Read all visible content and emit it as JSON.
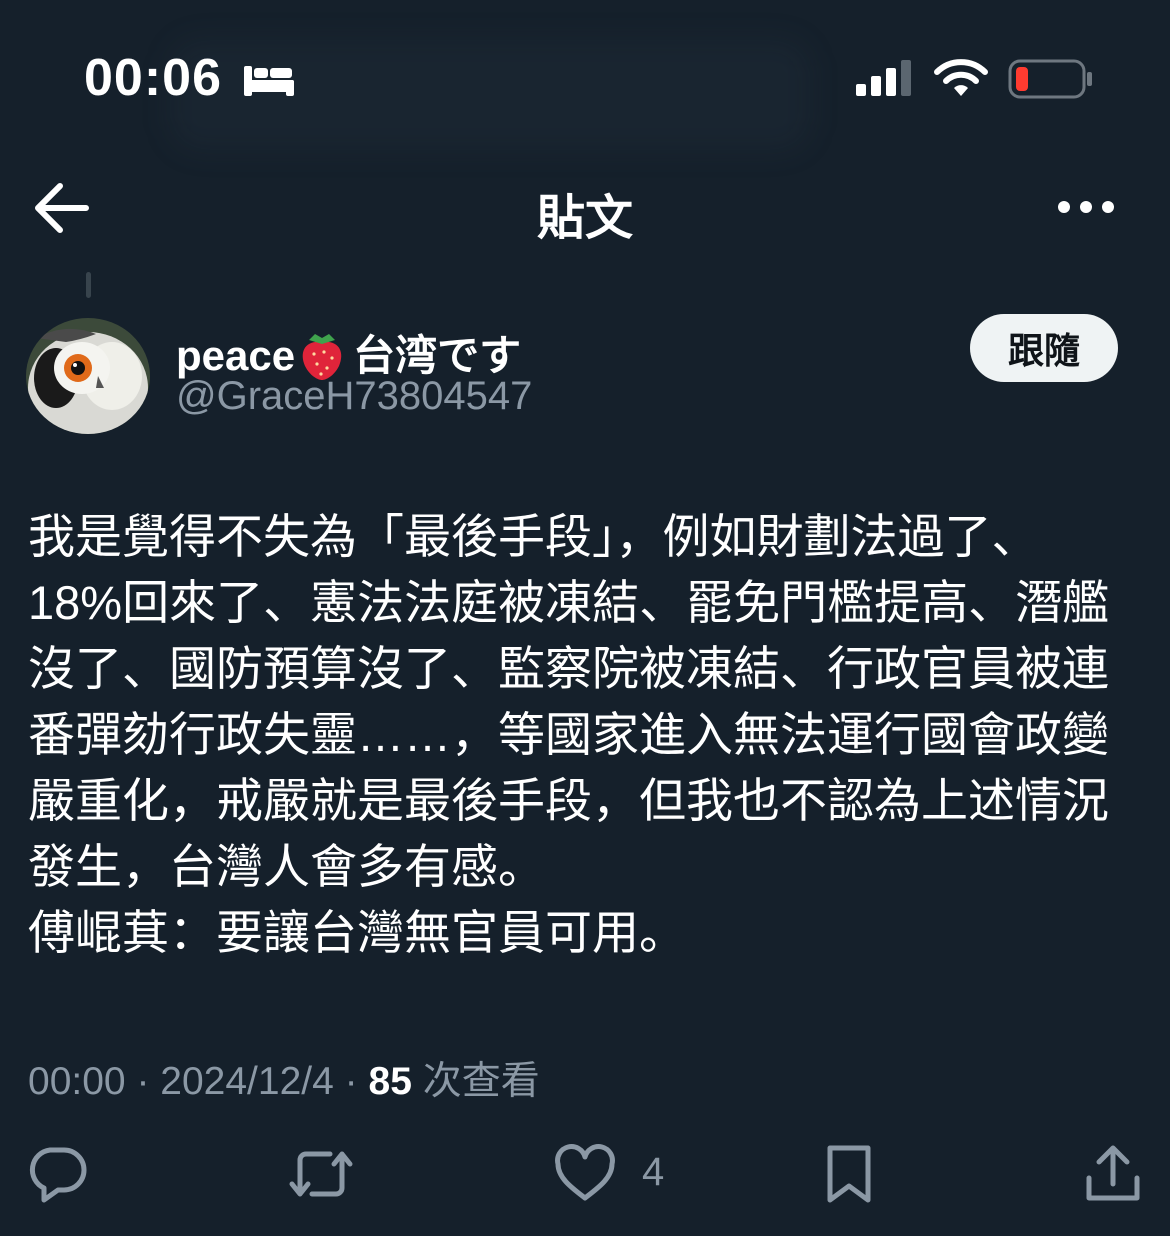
{
  "status_bar": {
    "time": "00:06",
    "icons": [
      "bed-icon",
      "cellular-signal-icon",
      "wifi-icon",
      "battery-low-icon"
    ],
    "battery_color": "#ff3b30"
  },
  "header": {
    "title": "貼文",
    "back_icon": "arrow-left-icon",
    "more_icon": "more-horizontal-icon"
  },
  "author": {
    "display_name": "peace",
    "name_emoji": "strawberry-icon",
    "name_suffix": "台湾です",
    "handle": "@GraceH73804547",
    "avatar": "owl-avatar"
  },
  "follow_button": {
    "label": "跟隨"
  },
  "post": {
    "lines": [
      "我是覺得不失為「最後手段」，例如財劃法過了、",
      "18%回來了、憲法法庭被凍結、罷免門檻提高、潛艦",
      "沒了、國防預算沒了、監察院被凍結、行政官員被連",
      "番彈劾行政失靈……，等國家進入無法運行國會政變",
      "嚴重化，戒嚴就是最後手段，但我也不認為上述情況",
      "發生，台灣人會多有感。",
      "傅崐萁：要讓台灣無官員可用。"
    ]
  },
  "meta": {
    "time": "00:00",
    "separator": "·",
    "date": "2024/12/4",
    "views_count": "85",
    "views_label": "次查看"
  },
  "actions": {
    "reply_icon": "reply-icon",
    "retweet_icon": "retweet-icon",
    "like_icon": "heart-icon",
    "like_count": "4",
    "bookmark_icon": "bookmark-icon",
    "share_icon": "share-icon"
  },
  "colors": {
    "background": "#15202b",
    "text": "#ffffff",
    "secondary_text": "#8b98a5",
    "button_bg": "#eff3f4"
  }
}
